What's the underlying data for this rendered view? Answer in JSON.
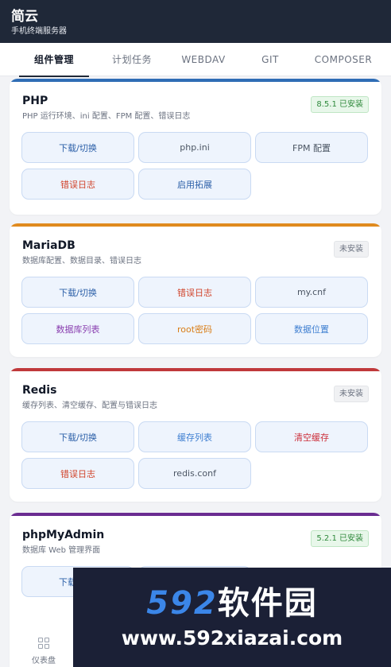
{
  "app": {
    "title": "简云",
    "subtitle": "手机终端服务器"
  },
  "tabs": [
    {
      "label": "组件管理",
      "active": true
    },
    {
      "label": "计划任务",
      "active": false
    },
    {
      "label": "WEBDAV",
      "active": false
    },
    {
      "label": "GIT",
      "active": false
    },
    {
      "label": "COMPOSER",
      "active": false
    }
  ],
  "cards": [
    {
      "title": "PHP",
      "desc": "PHP 运行环境、ini 配置、FPM 配置、错误日志",
      "status": "8.5.1 已安装",
      "accent": "#2f6db5",
      "buttons": [
        "下载/切换",
        "php.ini",
        "FPM 配置",
        "错误日志",
        "启用拓展"
      ]
    },
    {
      "title": "MariaDB",
      "desc": "数据库配置、数据目录、错误日志",
      "status": "未安装",
      "accent": "#e08a1e",
      "buttons": [
        "下载/切换",
        "错误日志",
        "my.cnf",
        "数据库列表",
        "root密码",
        "数据位置"
      ]
    },
    {
      "title": "Redis",
      "desc": "缓存列表、清空缓存、配置与错误日志",
      "status": "未安装",
      "accent": "#c0393b",
      "buttons": [
        "下载/切换",
        "缓存列表",
        "清空缓存",
        "错误日志",
        "redis.conf"
      ]
    },
    {
      "title": "phpMyAdmin",
      "desc": "数据库 Web 管理界面",
      "status": "5.2.1 已安装",
      "accent": "#6a2c91",
      "buttons": [
        "下载"
      ]
    }
  ],
  "watermark": {
    "logo_num": "592",
    "logo_cn": "软件园",
    "url": "www.592xiazai.com"
  },
  "bottom_nav": {
    "label": "仪表盘",
    "icon": "dashboard-grid-icon"
  }
}
